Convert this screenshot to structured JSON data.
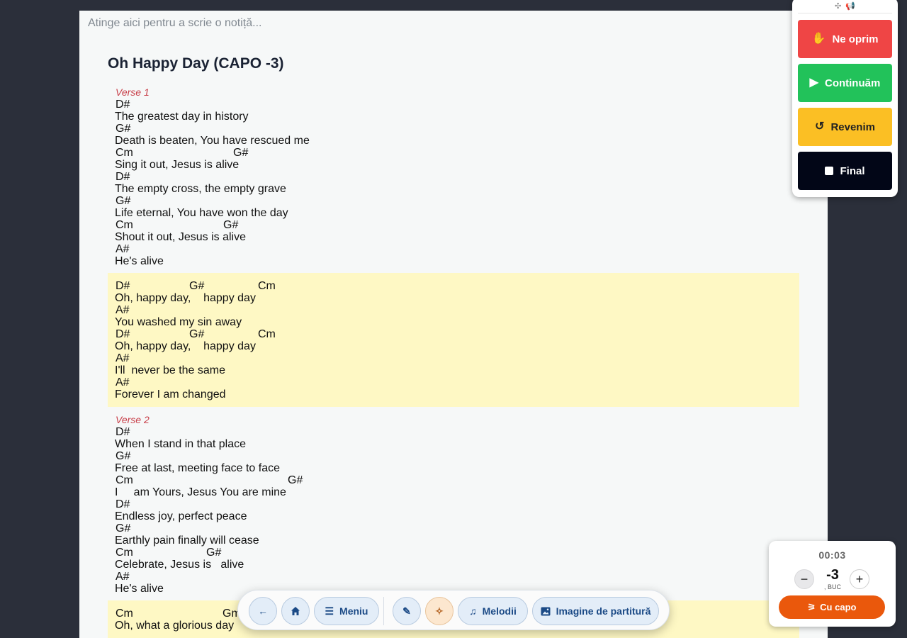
{
  "note": {
    "placeholder": "Atinge aici pentru a scrie o notiță..."
  },
  "song": {
    "title": "Oh Happy Day (CAPO -3)",
    "sections": [
      {
        "label": "Verse 1",
        "highlight": false,
        "lines": [
          {
            "chords": [
              {
                "c": "D#",
                "pos": 0
              }
            ],
            "lyric": "The greatest day in history"
          },
          {
            "chords": [
              {
                "c": "G#",
                "pos": 0
              }
            ],
            "lyric": "Death is beaten, You have rescued me"
          },
          {
            "chords": [
              {
                "c": "Cm",
                "pos": 0
              },
              {
                "c": "G#",
                "pos": 166
              }
            ],
            "lyric": "Sing it out, Jesus is alive"
          },
          {
            "chords": [
              {
                "c": "D#",
                "pos": 0
              }
            ],
            "lyric": "The empty cross, the empty grave"
          },
          {
            "chords": [
              {
                "c": "G#",
                "pos": 0
              }
            ],
            "lyric": "Life eternal, You have won the day"
          },
          {
            "chords": [
              {
                "c": "Cm",
                "pos": 0
              },
              {
                "c": "G#",
                "pos": 152
              }
            ],
            "lyric": "Shout it out, Jesus is alive"
          },
          {
            "chords": [
              {
                "c": "A#",
                "pos": 0
              }
            ],
            "lyric": "He's alive"
          }
        ]
      },
      {
        "label": "",
        "highlight": true,
        "lines": [
          {
            "chords": [
              {
                "c": "D#",
                "pos": 0
              },
              {
                "c": "G#",
                "pos": 104
              },
              {
                "c": "Cm",
                "pos": 201
              }
            ],
            "lyric": "Oh, happy day,    happy day"
          },
          {
            "chords": [
              {
                "c": "A#",
                "pos": 0
              }
            ],
            "lyric": "You washed my sin away"
          },
          {
            "chords": [
              {
                "c": "D#",
                "pos": 0
              },
              {
                "c": "G#",
                "pos": 104
              },
              {
                "c": "Cm",
                "pos": 201
              }
            ],
            "lyric": "Oh, happy day,    happy day"
          },
          {
            "chords": [
              {
                "c": "A#",
                "pos": 0
              }
            ],
            "lyric": "I'll  never be the same"
          },
          {
            "chords": [
              {
                "c": "A#",
                "pos": 0
              }
            ],
            "lyric": "Forever I am changed"
          }
        ]
      },
      {
        "label": "Verse 2",
        "highlight": false,
        "lines": [
          {
            "chords": [
              {
                "c": "D#",
                "pos": 0
              }
            ],
            "lyric": "When I stand in that place"
          },
          {
            "chords": [
              {
                "c": "G#",
                "pos": 0
              }
            ],
            "lyric": "Free at last, meeting face to face"
          },
          {
            "chords": [
              {
                "c": "Cm",
                "pos": 0
              },
              {
                "c": "G#",
                "pos": 243
              }
            ],
            "lyric": "I     am Yours, Jesus You are mine"
          },
          {
            "chords": [
              {
                "c": "D#",
                "pos": 0
              }
            ],
            "lyric": "Endless joy, perfect peace"
          },
          {
            "chords": [
              {
                "c": "G#",
                "pos": 0
              }
            ],
            "lyric": "Earthly pain finally will cease"
          },
          {
            "chords": [
              {
                "c": "Cm",
                "pos": 0
              },
              {
                "c": "G#",
                "pos": 128
              }
            ],
            "lyric": "Celebrate, Jesus is   alive"
          },
          {
            "chords": [
              {
                "c": "A#",
                "pos": 0
              }
            ],
            "lyric": "He's alive"
          }
        ]
      },
      {
        "label": "",
        "highlight": true,
        "lines": [
          {
            "chords": [
              {
                "c": "Cm",
                "pos": 0
              },
              {
                "c": "Gm",
                "pos": 151
              }
            ],
            "lyric": "Oh, what a glorious day"
          }
        ]
      }
    ]
  },
  "control_panel": {
    "stop_label": "Ne oprim",
    "continue_label": "Continuăm",
    "revert_label": "Revenim",
    "final_label": "Final",
    "colors": {
      "stop": "#ef4545",
      "continue": "#22c25a",
      "revert": "#fbbf24",
      "final": "#020617"
    }
  },
  "toolbar": {
    "menu_label": "Meniu",
    "songs_label": "Melodii",
    "sheet_label": "Imagine de partitură"
  },
  "capo": {
    "timer": "00:03",
    "value": "-3",
    "unit": ", BUC",
    "button_label": "Cu capo",
    "accent": "#ea580c"
  }
}
